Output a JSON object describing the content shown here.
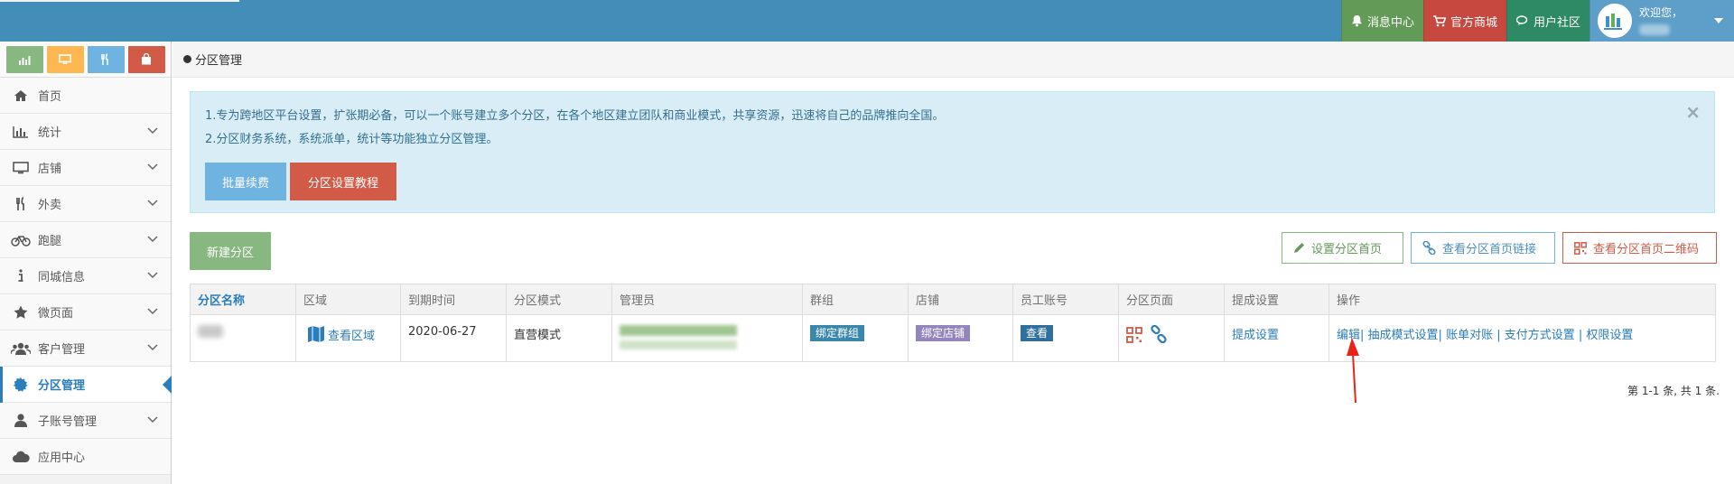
{
  "topbar": {
    "messages_label": "消息中心",
    "shop_label": "官方商城",
    "community_label": "用户社区",
    "welcome_label": "欢迎您，"
  },
  "sidebar": {
    "items": [
      {
        "label": "首页",
        "icon": "home-icon"
      },
      {
        "label": "统计",
        "icon": "bar-chart-icon"
      },
      {
        "label": "店铺",
        "icon": "desktop-icon"
      },
      {
        "label": "外卖",
        "icon": "cutlery-icon"
      },
      {
        "label": "跑腿",
        "icon": "bicycle-icon"
      },
      {
        "label": "同城信息",
        "icon": "info-icon"
      },
      {
        "label": "微页面",
        "icon": "star-icon"
      },
      {
        "label": "客户管理",
        "icon": "users-icon"
      },
      {
        "label": "分区管理",
        "icon": "cog-icon"
      },
      {
        "label": "子账号管理",
        "icon": "user-icon"
      },
      {
        "label": "应用中心",
        "icon": "cloud-icon"
      }
    ]
  },
  "breadcrumb": {
    "current": "分区管理"
  },
  "alert": {
    "line1": "1.专为跨地区平台设置，扩张期必备，可以一个账号建立多个分区，在各个地区建立团队和商业模式，共享资源，迅速将自己的品牌推向全国。",
    "line2": "2.分区财务系统，系统派单，统计等功能独立分区管理。",
    "close_label": "×",
    "batch_renew_label": "批量续费",
    "tutorial_label": "分区设置教程"
  },
  "toolbar": {
    "new_partition_label": "新建分区",
    "set_home_label": "设置分区首页",
    "view_link_label": "查看分区首页链接",
    "view_qr_label": "查看分区首页二维码"
  },
  "table": {
    "headers": [
      "分区名称",
      "区域",
      "到期时间",
      "分区模式",
      "管理员",
      "群组",
      "店铺",
      "员工账号",
      "分区页面",
      "提成设置",
      "操作"
    ],
    "row": {
      "region_link": "查看区域",
      "expire": "2020-06-27",
      "mode": "直营模式",
      "group_label": "绑定群组",
      "shop_label": "绑定店铺",
      "staff_label": "查看",
      "commission_label": "提成设置",
      "ops": [
        "编辑",
        "抽成模式设置",
        "账单对账",
        "支付方式设置",
        "权限设置"
      ]
    }
  },
  "pager": {
    "summary": "第 1-1 条, 共 1 条."
  },
  "colors": {
    "topbar": "#438eb9",
    "accent_blue": "#2b7dbc",
    "alert_bg": "#d9edf7",
    "green": "#87b87f",
    "red": "#d15b47"
  }
}
